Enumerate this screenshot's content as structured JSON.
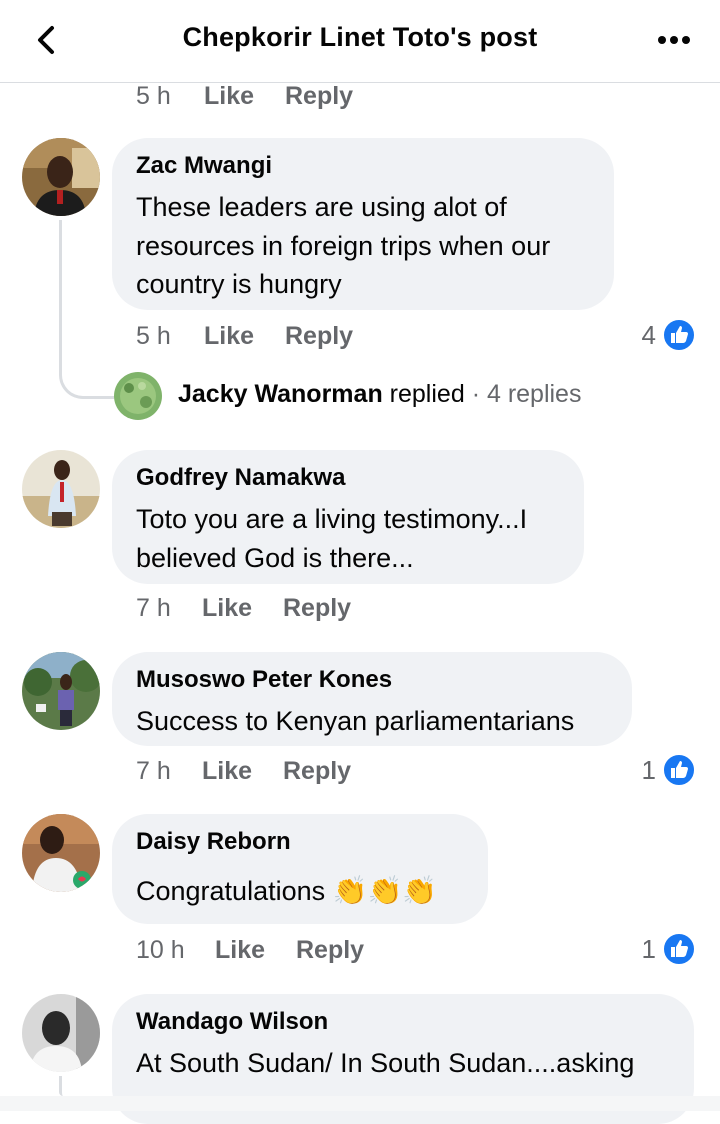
{
  "header": {
    "title": "Chepkorir Linet Toto's post",
    "back_icon": "chevron-left-icon",
    "more_icon": "more-horizontal-icon"
  },
  "top_meta": {
    "time": "5 h",
    "like": "Like",
    "reply": "Reply"
  },
  "comments": [
    {
      "name": "Zac Mwangi",
      "text": "These leaders are using alot of resources in foreign trips when our country is hungry",
      "time": "5 h",
      "like": "Like",
      "reply": "Reply",
      "reactions": "4"
    },
    {
      "name": "Godfrey Namakwa",
      "text": "Toto you are a living testimony...I believed God is there...",
      "time": "7 h",
      "like": "Like",
      "reply": "Reply",
      "reactions": ""
    },
    {
      "name": "Musoswo Peter Kones",
      "text": "Success to Kenyan parliamentarians",
      "time": "7 h",
      "like": "Like",
      "reply": "Reply",
      "reactions": "1"
    },
    {
      "name": "Daisy Reborn",
      "text": "Congratulations",
      "emoji": "👏👏👏",
      "time": "10 h",
      "like": "Like",
      "reply": "Reply",
      "reactions": "1"
    },
    {
      "name": "Wandago Wilson",
      "text": "At South Sudan/ In South Sudan....asking",
      "reactions": ""
    }
  ],
  "reply_summary": {
    "name": "Jacky Wanorman",
    "verb": "replied",
    "separator": "·",
    "count": "4 replies"
  },
  "colors": {
    "like_blue": "#1877f2",
    "bubble": "#f0f2f5",
    "meta_gray": "#65676b"
  }
}
